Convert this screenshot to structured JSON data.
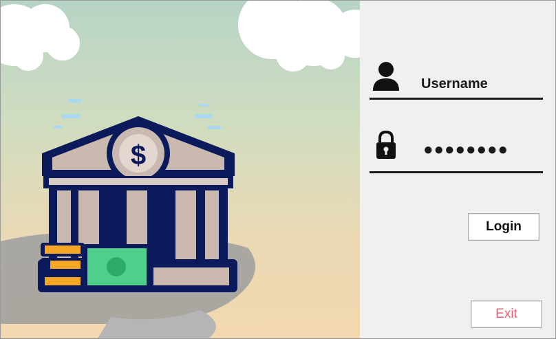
{
  "login_form": {
    "username_value": "Username",
    "password_value": "●●●●●●●●",
    "login_label": "Login",
    "exit_label": "Exit",
    "user_icon": "user-icon",
    "lock_icon": "lock-icon"
  },
  "illustration": {
    "subject": "bank-building-icon",
    "currency_symbol": "$",
    "colors": {
      "navy": "#0b1a5a",
      "pillar": "#c9b9b0",
      "bill_green": "#4ed08a",
      "coin_gold": "#f5a623"
    }
  },
  "colors": {
    "panel_background": "#f0f0f0",
    "exit_text": "#e06478",
    "underline": "#1a1a1a"
  }
}
